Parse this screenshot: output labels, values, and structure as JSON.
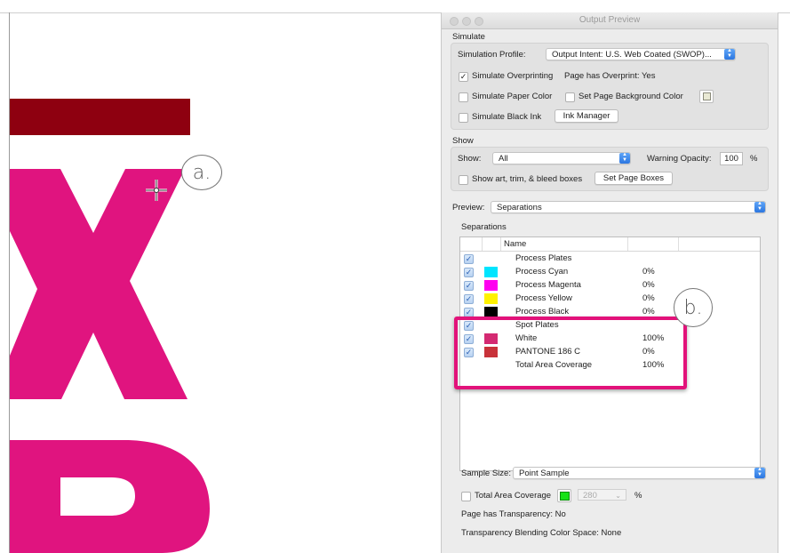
{
  "window": {
    "title": "Output Preview"
  },
  "callouts": {
    "a": "a.",
    "b": "b."
  },
  "colors": {
    "magenta_art": "#e0147f",
    "dark_red_art": "#8e0010",
    "highlight": "#e2127a",
    "accent_blue": "#2c76e0"
  },
  "simulate": {
    "section_label": "Simulate",
    "profile_label": "Simulation Profile:",
    "profile_value": "Output Intent: U.S. Web Coated (SWOP)...",
    "overprint": {
      "label": "Simulate Overprinting",
      "checked": true
    },
    "page_has_overprint": "Page has Overprint:  Yes",
    "paper_color": {
      "label": "Simulate Paper Color",
      "checked": false
    },
    "page_bg": {
      "label": "Set Page Background Color",
      "checked": false
    },
    "black_ink": {
      "label": "Simulate Black Ink",
      "checked": false
    },
    "ink_manager": "Ink Manager"
  },
  "show": {
    "section_label": "Show",
    "show_label": "Show:",
    "show_value": "All",
    "warning_label": "Warning Opacity:",
    "warning_value": "100",
    "percent": "%",
    "boxes": {
      "label": "Show art, trim, & bleed boxes",
      "checked": false
    },
    "set_boxes": "Set Page Boxes"
  },
  "preview": {
    "label": "Preview:",
    "value": "Separations"
  },
  "separations": {
    "section_label": "Separations",
    "column_name": "Name",
    "rows": [
      {
        "name": "Process Plates",
        "pct": "",
        "color": "",
        "checked": true
      },
      {
        "name": "Process Cyan",
        "pct": "0%",
        "color": "#00e5ff",
        "checked": true
      },
      {
        "name": "Process Magenta",
        "pct": "0%",
        "color": "#ff00f0",
        "checked": true
      },
      {
        "name": "Process Yellow",
        "pct": "0%",
        "color": "#fff200",
        "checked": true
      },
      {
        "name": "Process Black",
        "pct": "0%",
        "color": "#000000",
        "checked": true
      },
      {
        "name": "Spot Plates",
        "pct": "",
        "color": "",
        "checked": true
      },
      {
        "name": "White",
        "pct": "100%",
        "color": "#d42a72",
        "checked": true
      },
      {
        "name": "PANTONE 186 C",
        "pct": "0%",
        "color": "#c8323a",
        "checked": true
      },
      {
        "name": "Total Area Coverage",
        "pct": "100%",
        "color": "",
        "checked": false
      }
    ]
  },
  "sample": {
    "label": "Sample Size:",
    "value": "Point Sample"
  },
  "total_area": {
    "label": "Total Area Coverage",
    "checked": false,
    "value": "280",
    "percent": "%"
  },
  "transparency": {
    "label": "Page has Transparency:  No",
    "blending": "Transparency Blending Color Space:  None"
  },
  "icons": {
    "crosshair": "crosshair-cursor-icon",
    "checkmark": "checkmark-icon",
    "popup": "popup-arrows-icon"
  }
}
